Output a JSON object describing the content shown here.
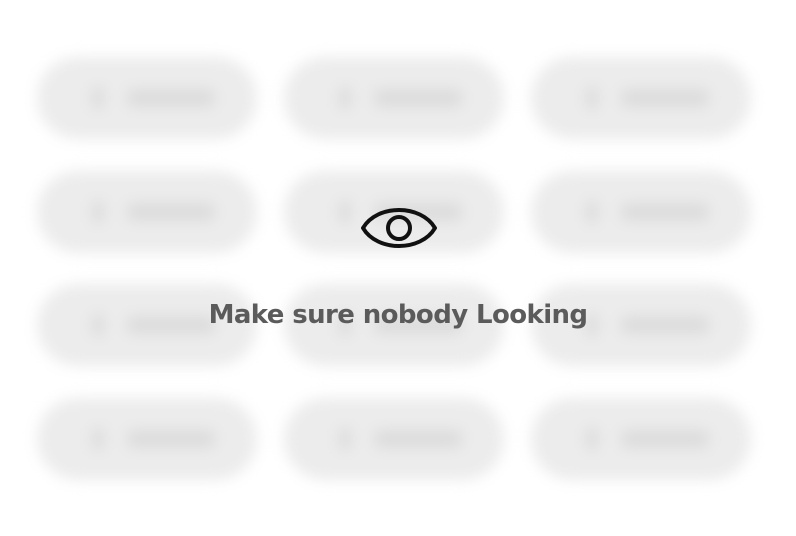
{
  "overlay": {
    "icon": "eye-icon",
    "message": "Make sure nobody Looking"
  },
  "colors": {
    "background": "#ffffff",
    "pill": "#ececec",
    "text": "#5b5b5b",
    "icon_stroke": "#111111"
  },
  "hidden_grid": {
    "rows": 4,
    "columns": 3,
    "state": "blurred"
  }
}
